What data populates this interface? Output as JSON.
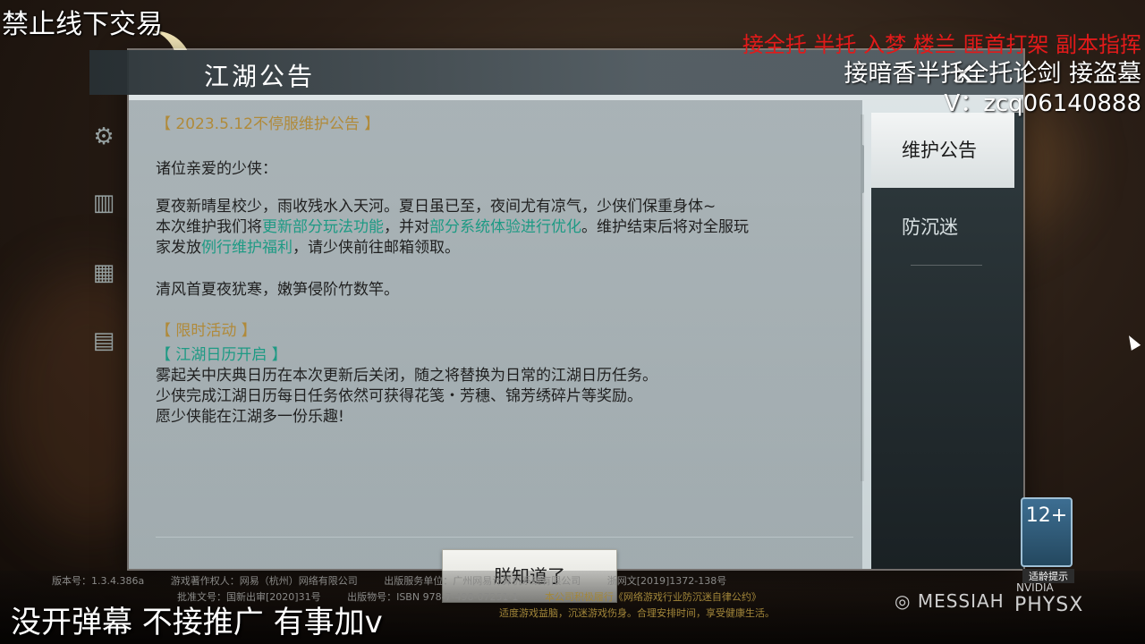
{
  "overlays": {
    "top_left": "禁止线下交易",
    "top_right_red": "接全托 半托 入梦 楼兰 匪首打架 副本指挥",
    "top_right_white": "接暗香半托全托论剑 接盗墓",
    "top_right_contact": "V：zcq06140888",
    "bottom_left": "没开弹幕 不接推广 有事加v"
  },
  "window": {
    "title": "江湖公告"
  },
  "announcement": {
    "heading": "【 2023.5.12不停服维护公告 】",
    "greeting": "诸位亲爱的少侠：",
    "line1": "夏夜新晴星校少，雨收残水入天河。夏日虽已至，夜间尤有凉气，少侠们保重身体~",
    "line2_a": "本次维护我们将",
    "line2_link1": "更新部分玩法功能",
    "line2_b": "，并对",
    "line2_link2": "部分系统体验进行优化",
    "line2_c": "。维护结束后将对全服玩",
    "line3_a": "家发放",
    "line3_link": "例行维护福利",
    "line3_b": "，请少侠前往邮箱领取。",
    "poem": "清风首夏夜犹寒，嫩笋侵阶竹数竿。",
    "section_title": "【 限时活动 】",
    "sub_title": "【 江湖日历开启 】",
    "act1": "雾起关中庆典日历在本次更新后关闭，随之将替换为日常的江湖日历任务。",
    "act2": "少侠完成江湖日历每日任务依然可获得花笺・芳穗、锦芳绣碎片等奖励。",
    "act3": "愿少侠能在江湖多一份乐趣!"
  },
  "buttons": {
    "ok": "朕知道了"
  },
  "tabs": {
    "active": "维护公告",
    "inactive": "防沉迷"
  },
  "footer": {
    "version": "版本号：1.3.4.386a",
    "copyright_owner": "游戏著作权人：网易（杭州）网络有限公司",
    "publisher": "出版服务单位：广州网易计算机系统有限公司",
    "license": "浙网文[2019]1372-138号",
    "approval": "批准文号：国新出审[2020]31号",
    "isbn": "出版物号：ISBN 978-7-498-07251-1",
    "notice": "本公司积极履行《网络游戏行业防沉迷自律公约》",
    "health": "适度游戏益脑，沉迷游戏伤身。合理安排时间，享受健康生活。"
  },
  "age_badge": {
    "rating": "12+",
    "label": "适龄提示"
  },
  "logos": {
    "messiah": "MESSIAH",
    "nvidia": "NVIDIA",
    "physx": "PHYSX"
  },
  "colors": {
    "link_teal": "#1e9a84",
    "heading_gold": "#b08a3a",
    "overlay_red": "#e21a1a"
  }
}
